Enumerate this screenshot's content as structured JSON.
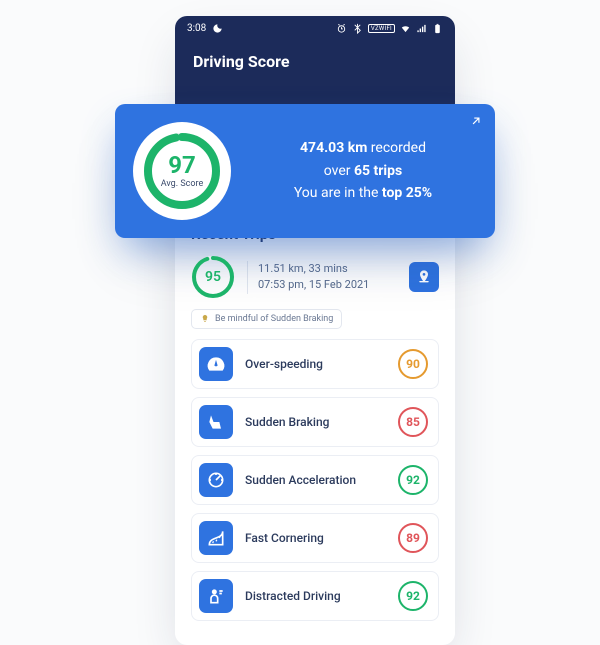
{
  "status": {
    "time": "3:08",
    "vzwifi": "VZWIFI"
  },
  "header": {
    "title": "Driving Score"
  },
  "summary": {
    "score": "97",
    "score_label": "Avg. Score",
    "distance": "474.03 km",
    "recorded_word": " recorded",
    "over_word": "over ",
    "trips": "65 trips",
    "rank_prefix": "You are in the ",
    "rank": "top 25%"
  },
  "recent_title": "Recent Trips",
  "trip": {
    "score": "95",
    "line1": "11.51 km, 33 mins",
    "line2": "07:53 pm, 15 Feb 2021"
  },
  "tip": {
    "text": "Be mindful of Sudden Braking"
  },
  "metrics": {
    "overspeed": {
      "label": "Over-speeding",
      "score": "90",
      "tone": "warn"
    },
    "braking": {
      "label": "Sudden Braking",
      "score": "85",
      "tone": "bad"
    },
    "accel": {
      "label": "Sudden Acceleration",
      "score": "92",
      "tone": "good"
    },
    "corner": {
      "label": "Fast Cornering",
      "score": "89",
      "tone": "bad"
    },
    "distracted": {
      "label": "Distracted Driving",
      "score": "92",
      "tone": "good"
    }
  },
  "chart_data": [
    {
      "type": "gauge",
      "name": "avg_score",
      "value": 97,
      "min": 0,
      "max": 100,
      "label": "Avg. Score"
    },
    {
      "type": "gauge",
      "name": "trip_score",
      "value": 95,
      "min": 0,
      "max": 100
    }
  ]
}
